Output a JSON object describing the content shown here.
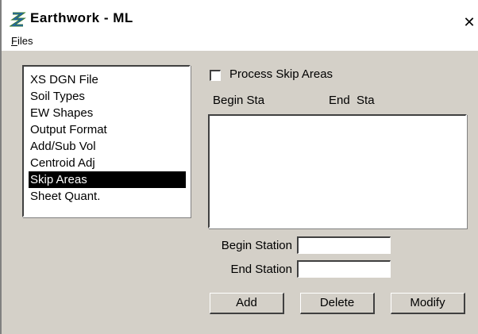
{
  "window": {
    "title": "Earthwork - ML",
    "close_glyph": "✕"
  },
  "menubar": {
    "files_mnemonic": "F",
    "files_rest": "iles"
  },
  "sidebar": {
    "items": [
      {
        "label": "XS DGN File"
      },
      {
        "label": "Soil Types"
      },
      {
        "label": "EW Shapes"
      },
      {
        "label": "Output Format"
      },
      {
        "label": "Add/Sub Vol"
      },
      {
        "label": "Centroid Adj"
      },
      {
        "label": "Skip Areas",
        "selected": true
      },
      {
        "label": "Sheet Quant."
      }
    ]
  },
  "skip_areas": {
    "process_checkbox": {
      "label": "Process Skip Areas",
      "checked": false
    },
    "columns": {
      "begin": "Begin Sta",
      "end": "End  Sta"
    },
    "rows": [],
    "begin_station": {
      "label": "Begin Station",
      "value": ""
    },
    "end_station": {
      "label": "End Station",
      "value": ""
    },
    "buttons": {
      "add": "Add",
      "delete": "Delete",
      "modify": "Modify"
    }
  },
  "colors": {
    "dialog_bg": "#d4d0c8",
    "selection_bg": "#000000",
    "icon_green": "#3a7d2a"
  },
  "icons": {
    "app": "bentley-b-icon"
  }
}
